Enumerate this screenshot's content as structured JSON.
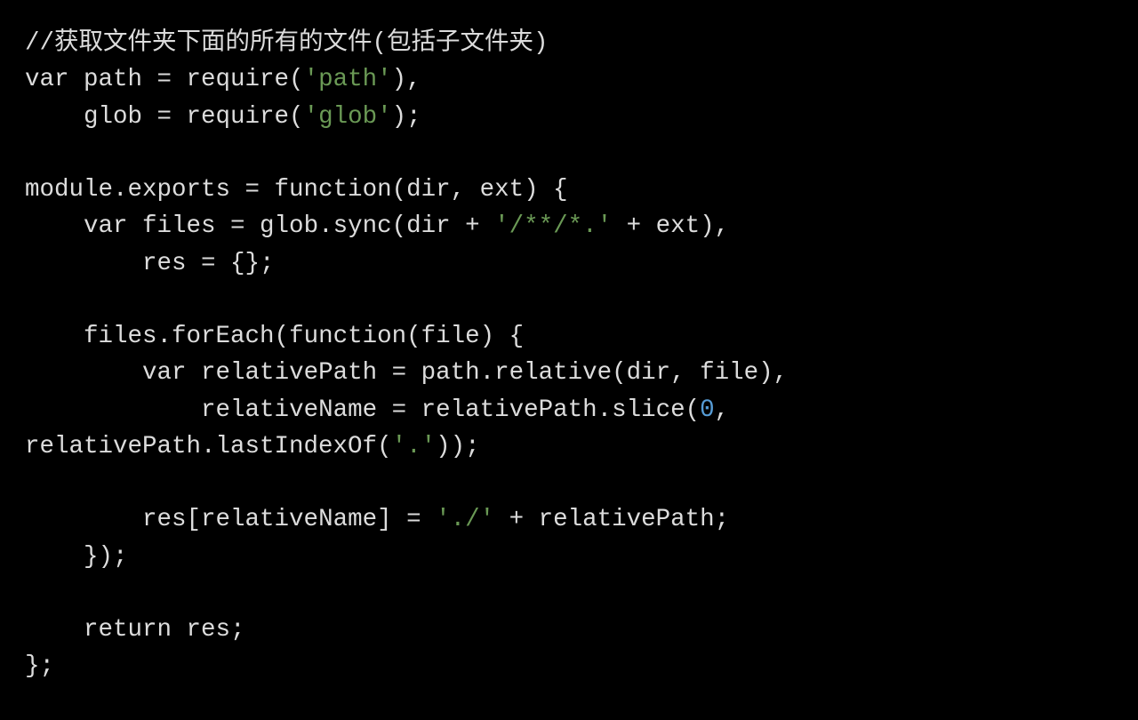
{
  "code": {
    "tokens": [
      {
        "cls": "c-comment",
        "text": "//获取文件夹下面的所有的文件(包括子文件夹)"
      },
      {
        "cls": "c-default",
        "text": "\n"
      },
      {
        "cls": "c-keyword",
        "text": "var"
      },
      {
        "cls": "c-default",
        "text": " path = require("
      },
      {
        "cls": "c-string",
        "text": "'path'"
      },
      {
        "cls": "c-default",
        "text": "),\n    glob = require("
      },
      {
        "cls": "c-string",
        "text": "'glob'"
      },
      {
        "cls": "c-default",
        "text": ");\n\nmodule.exports = "
      },
      {
        "cls": "c-keyword",
        "text": "function"
      },
      {
        "cls": "c-default",
        "text": "(dir, ext) {\n    "
      },
      {
        "cls": "c-keyword",
        "text": "var"
      },
      {
        "cls": "c-default",
        "text": " files = glob.sync(dir + "
      },
      {
        "cls": "c-string",
        "text": "'/**/*.'"
      },
      {
        "cls": "c-default",
        "text": " + ext),\n        res = {};\n\n    files.forEach("
      },
      {
        "cls": "c-keyword",
        "text": "function"
      },
      {
        "cls": "c-default",
        "text": "(file) {\n        "
      },
      {
        "cls": "c-keyword",
        "text": "var"
      },
      {
        "cls": "c-default",
        "text": " relativePath = path.relative(dir, file),\n            relativeName = relativePath.slice("
      },
      {
        "cls": "c-number",
        "text": "0"
      },
      {
        "cls": "c-default",
        "text": ", relativePath.lastIndexOf("
      },
      {
        "cls": "c-string",
        "text": "'.'"
      },
      {
        "cls": "c-default",
        "text": "));\n\n        res[relativeName] = "
      },
      {
        "cls": "c-string",
        "text": "'./'"
      },
      {
        "cls": "c-default",
        "text": " + relativePath;\n    });\n\n    "
      },
      {
        "cls": "c-keyword",
        "text": "return"
      },
      {
        "cls": "c-default",
        "text": " res;\n};"
      }
    ]
  }
}
